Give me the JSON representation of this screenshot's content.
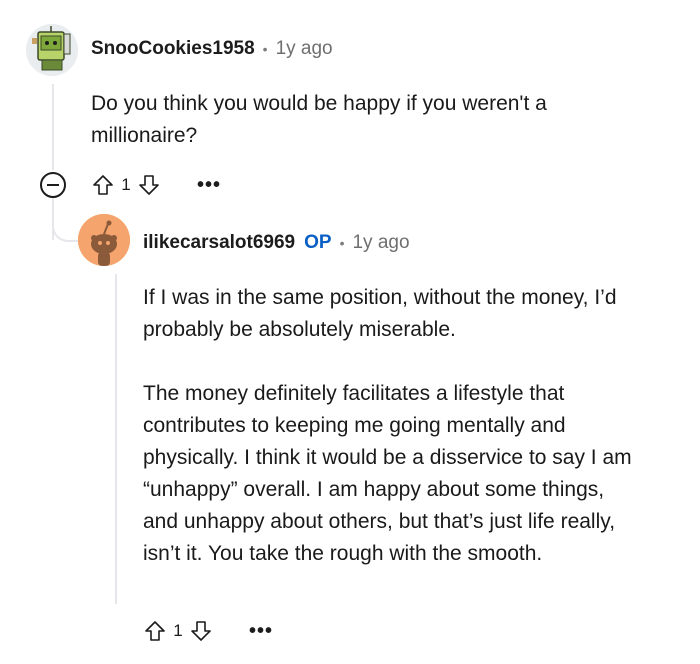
{
  "colors": {
    "op_accent": "#0a5fc4",
    "thread_line": "#e5e7ea",
    "snoo_avatar_bg": "#f4a46c"
  },
  "comments": [
    {
      "author": "SnooCookies1958",
      "time": "1y ago",
      "body": [
        "Do you think you would be happy if you weren't a millionaire?"
      ],
      "votes": "1",
      "avatar_icon": "cookie-snoo-icon"
    },
    {
      "author": "ilikecarsalot6969",
      "op_badge": "OP",
      "time": "1y ago",
      "body": [
        "If I was in the same position, without the money, I’d probably be absolutely miserable.",
        "The money definitely facilitates a lifestyle that contributes to keeping me going mentally and physically. I think it would be a disservice to say I am “unhappy” overall. I am happy about some things, and unhappy about others, but that’s just life really, isn’t it. You take the rough with the smooth."
      ],
      "votes": "1",
      "avatar_icon": "snoo-icon"
    }
  ],
  "separator": "•",
  "more_label": "•••"
}
